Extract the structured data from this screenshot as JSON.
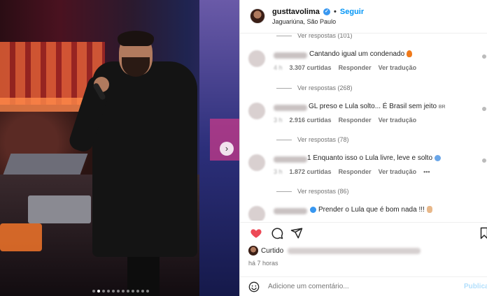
{
  "post": {
    "username": "gusttavolima",
    "follow_label": "Seguir",
    "location": "Jaguariúna, São Paulo",
    "image_dots": 12,
    "active_dot": 1
  },
  "comments": {
    "top_replies": "Ver respostas (101)",
    "items": [
      {
        "text": "Cantando igual um condenado",
        "emoji": "fire",
        "likes": "3.307 curtidas",
        "reply": "Responder",
        "translate": "Ver tradução",
        "replies": "Ver respostas (268)"
      },
      {
        "text": "GL preso e Lula solto... É Brasil sem jeito",
        "emoji": "flag",
        "flag_text": "BR",
        "likes": "2.916 curtidas",
        "reply": "Responder",
        "translate": "Ver tradução",
        "replies": "Ver respostas (78)"
      },
      {
        "text": "1 Enquanto isso o Lula livre, leve e solto",
        "emoji": "brain",
        "likes": "1.872 curtidas",
        "reply": "Responder",
        "translate": "Ver tradução",
        "more": "•••",
        "replies": "Ver respostas (86)"
      },
      {
        "text": "Prender o Lula que é bom nada !!!",
        "emoji": "thumb"
      }
    ]
  },
  "footer": {
    "liked_prefix": "Curtido",
    "time": "há 7 horas",
    "add_placeholder": "Adicione um comentário...",
    "publish": "Publicar"
  },
  "colors": {
    "accent": "#0095f6",
    "like": "#ed4956"
  }
}
